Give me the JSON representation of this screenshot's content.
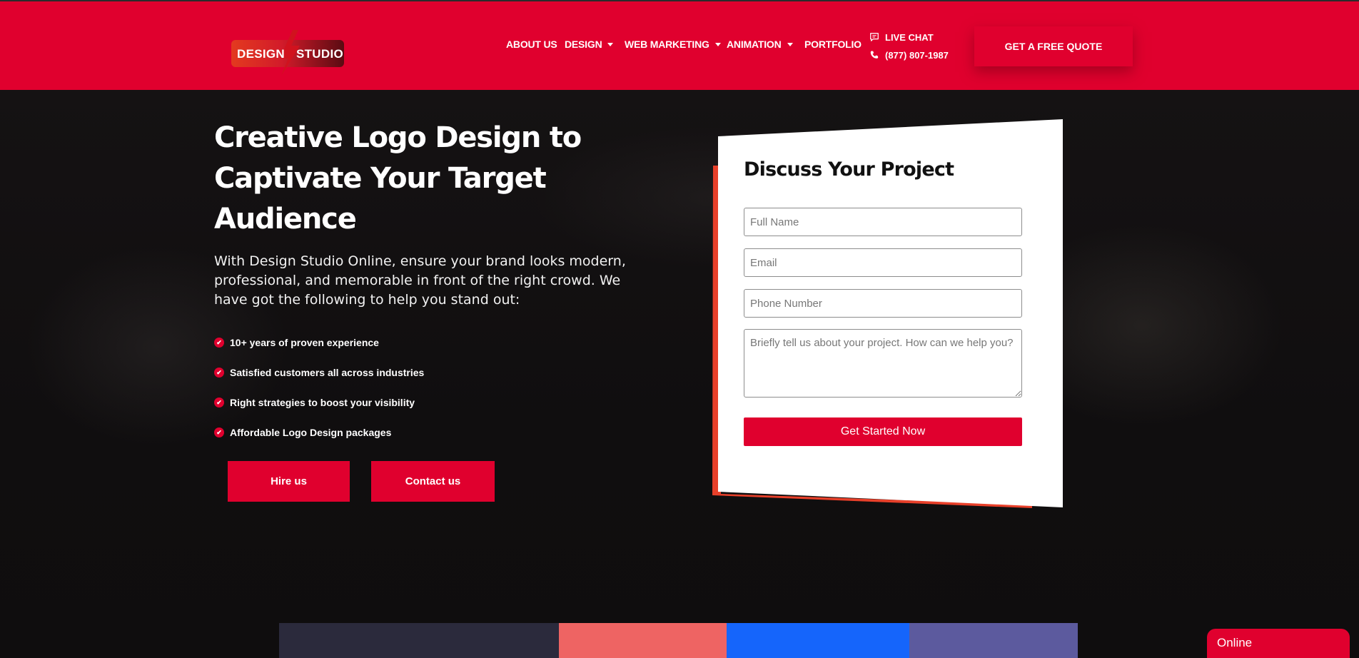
{
  "header": {
    "logo": {
      "word1": "DESIGN",
      "word2": "STUDIO"
    },
    "nav": [
      {
        "label": "ABOUT US",
        "has_dropdown": false
      },
      {
        "label": "DESIGN",
        "has_dropdown": true
      },
      {
        "label": "WEB MARKETING",
        "has_dropdown": true
      },
      {
        "label": "ANIMATION",
        "has_dropdown": true
      },
      {
        "label": "PORTFOLIO",
        "has_dropdown": false
      }
    ],
    "live_chat": "LIVE CHAT",
    "phone": "(877) 807-1987",
    "quote_button": "GET A FREE QUOTE"
  },
  "hero": {
    "headline": "Creative Logo Design to Captivate Your Target Audience",
    "intro": "With Design Studio Online, ensure your brand looks modern, professional, and memorable in front of the right crowd. We have got the following to help you stand out:",
    "features": [
      "10+ years of proven experience",
      "Satisfied customers all across industries",
      "Right strategies to boost your visibility",
      "Affordable Logo Design packages"
    ],
    "hire_button": "Hire us",
    "contact_button": "Contact us"
  },
  "form": {
    "title": "Discuss Your Project",
    "name_placeholder": "Full Name",
    "email_placeholder": "Email",
    "phone_placeholder": "Phone Number",
    "message_placeholder": "Briefly tell us about your project. How can we help you?",
    "submit": "Get Started Now"
  },
  "chat_widget": {
    "label": "Online"
  },
  "colors": {
    "brand_red": "#e0002e",
    "accent_orange": "#e8402a",
    "background": "#0f0d0e",
    "strip": [
      "#2b2a3c",
      "#ee6463",
      "#1565fb",
      "#5c5a9e"
    ]
  }
}
